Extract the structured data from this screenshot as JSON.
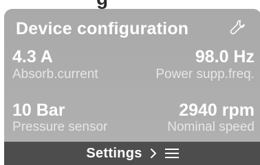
{
  "top_fragment": "g",
  "card": {
    "title": "Device configuration",
    "action_icon": "wrench-icon"
  },
  "metrics": [
    {
      "value": "4.3 A",
      "label": "Absorb.current"
    },
    {
      "value": "98.0 Hz",
      "label": "Power supp.freq."
    },
    {
      "value": "10 Bar",
      "label": "Pressure sensor"
    },
    {
      "value": "2940 rpm",
      "label": "Nominal speed"
    }
  ],
  "footer": {
    "label": "Settings",
    "icons": [
      "chevron-right-icon",
      "menu-icon"
    ]
  },
  "colors": {
    "card_background": "#adadad",
    "footer_background": "#4d4d4d",
    "text": "#ffffff",
    "label_text": "#e6e6e6"
  }
}
